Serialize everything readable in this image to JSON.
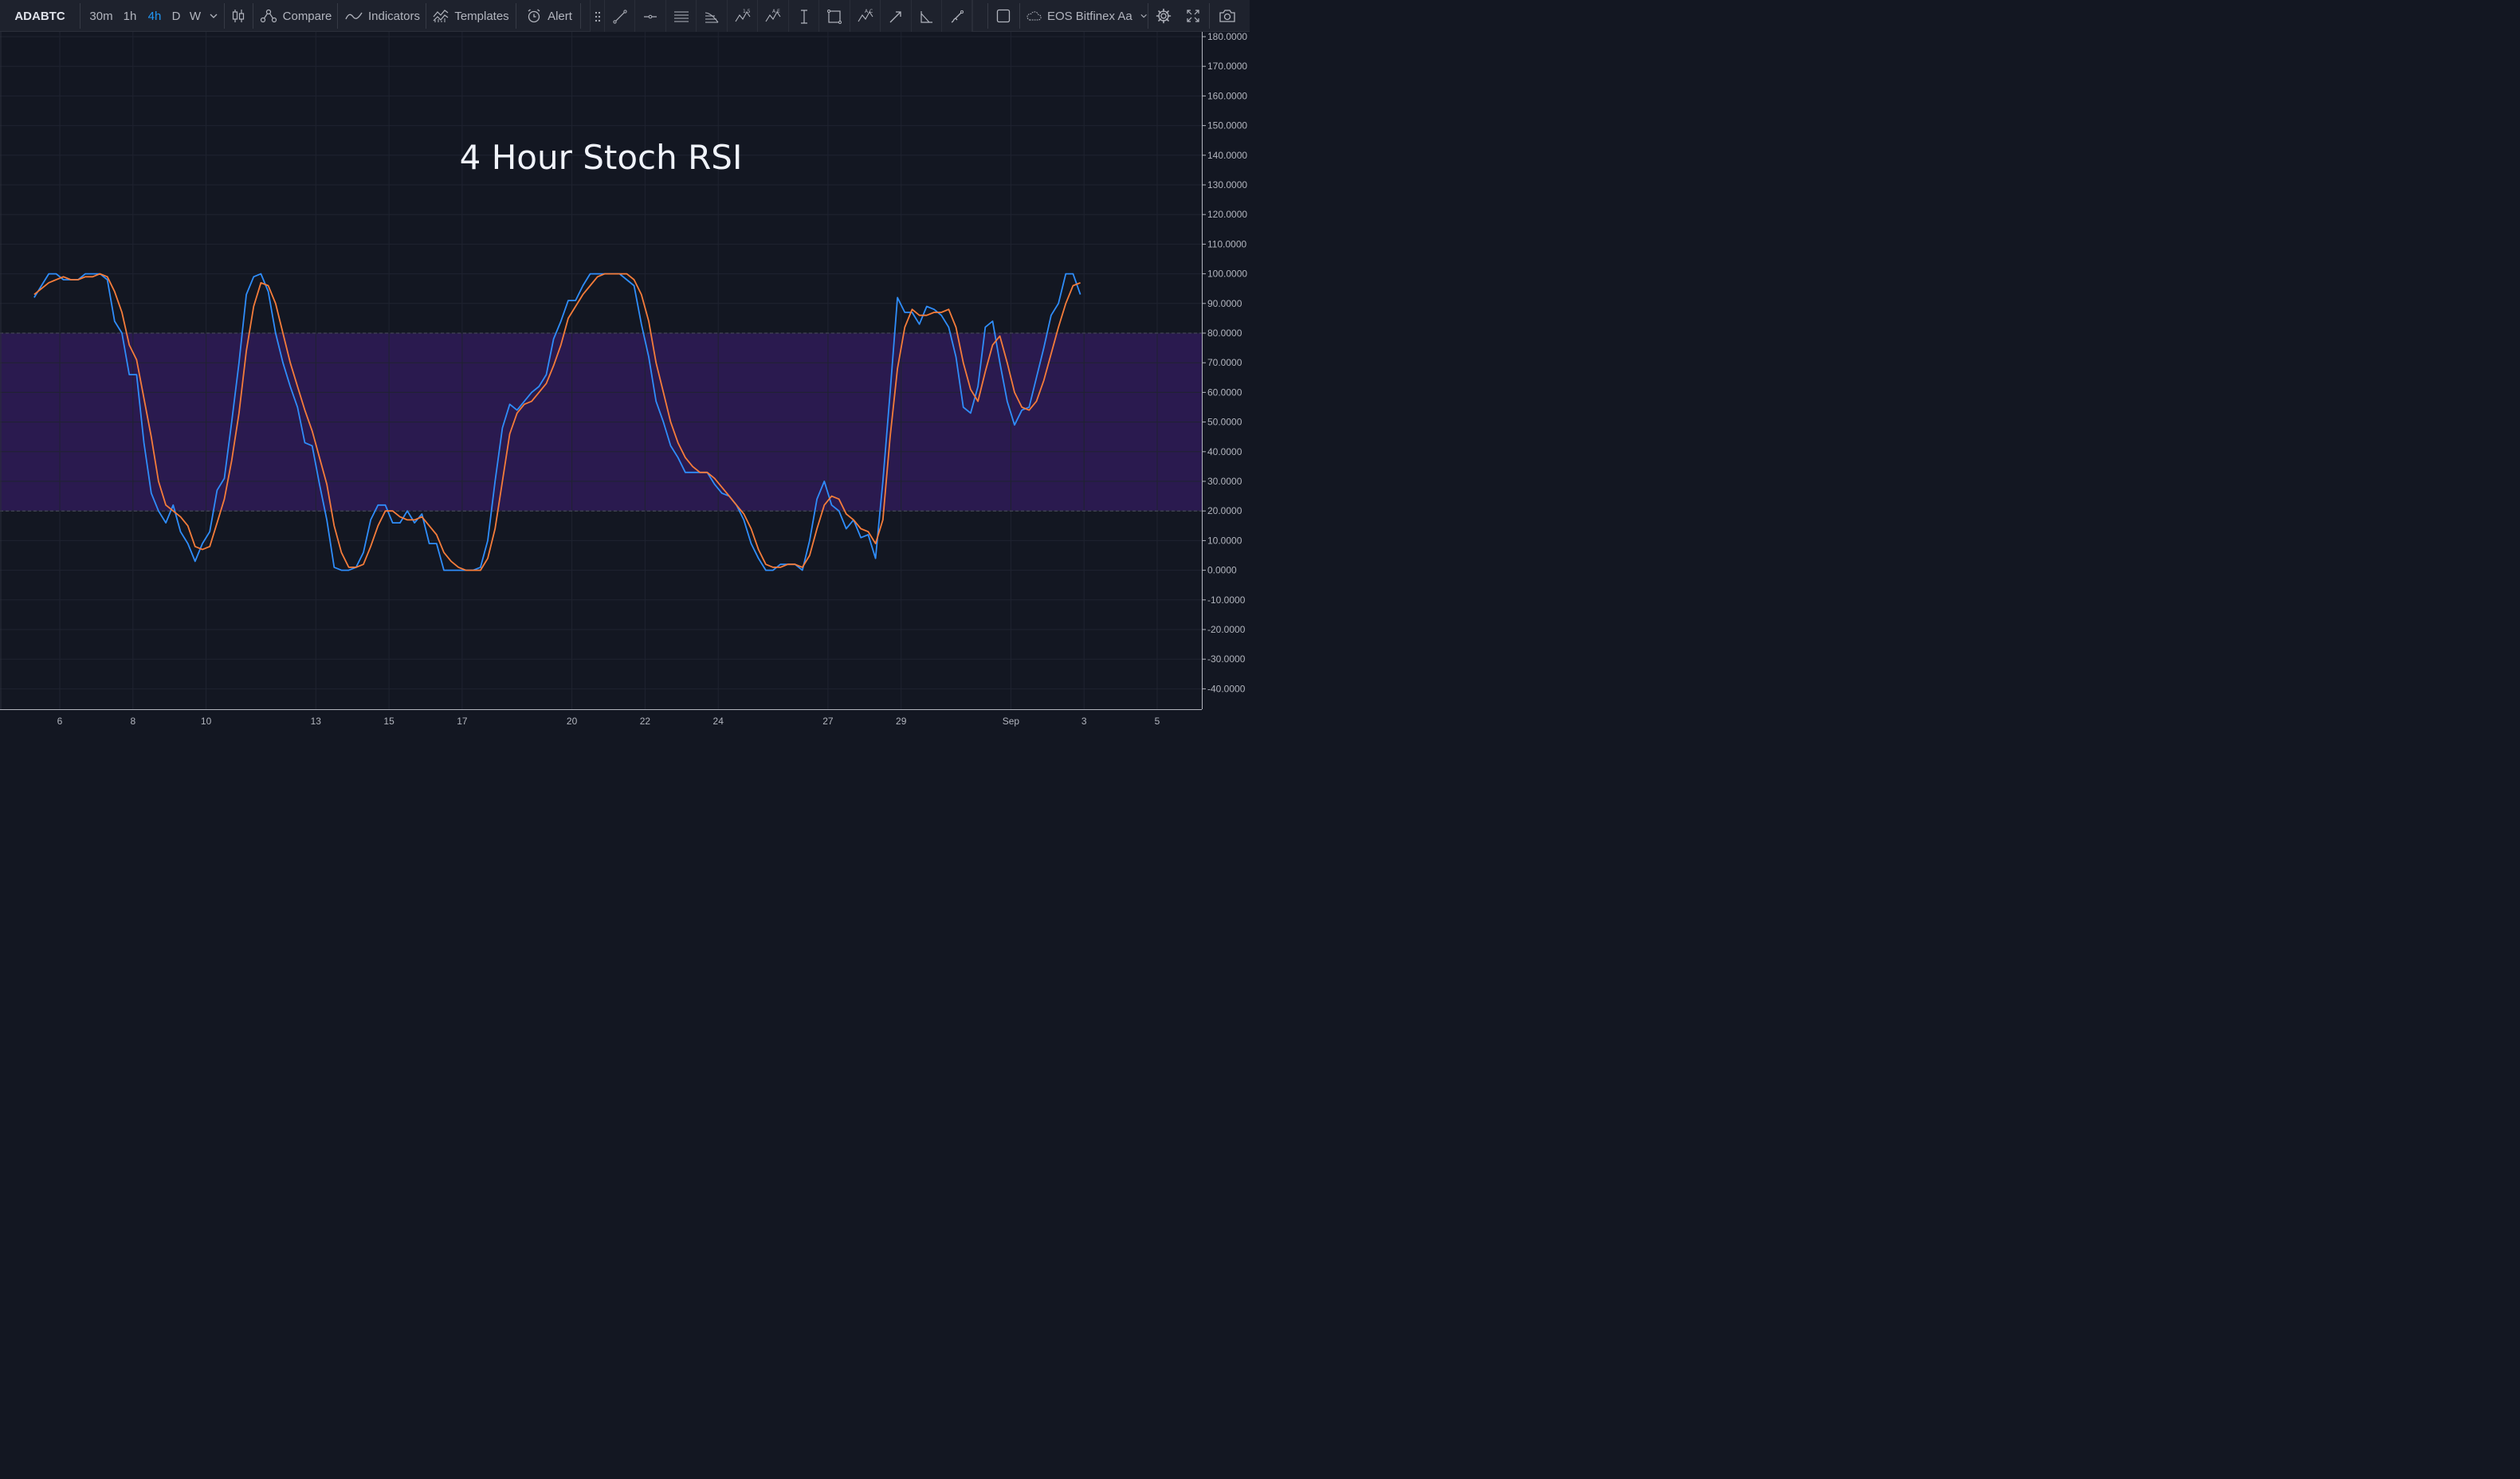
{
  "toolbar": {
    "symbol": "ADABTC",
    "intervals": [
      {
        "label": "30m",
        "active": false
      },
      {
        "label": "1h",
        "active": false
      },
      {
        "label": "4h",
        "active": true
      },
      {
        "label": "D",
        "active": false
      },
      {
        "label": "W",
        "active": false
      }
    ],
    "compare_label": "Compare",
    "indicators_label": "Indicators",
    "templates_label": "Templates",
    "alert_label": "Alert",
    "template_name": "EOS Bitfinex Aa",
    "accent_color": "#2196f3"
  },
  "drawing_tools": [
    "trend-line-icon",
    "horizontal-ray-icon",
    "parallel-lines-icon",
    "fib-retracement-icon",
    "pattern-15-icon",
    "pattern-ae-icon",
    "date-range-icon",
    "rectangle-icon",
    "pattern-ac-icon",
    "arrow-icon",
    "angle-icon",
    "brush-icon"
  ],
  "chart_data": {
    "type": "line",
    "title": "4 Hour Stoch RSI",
    "x_tick_labels": [
      "6",
      "8",
      "10",
      "13",
      "15",
      "17",
      "20",
      "22",
      "24",
      "27",
      "29",
      "Sep",
      "3",
      "5"
    ],
    "y_tick_labels": [
      "180.0000",
      "170.0000",
      "160.0000",
      "150.0000",
      "140.0000",
      "130.0000",
      "120.0000",
      "110.0000",
      "100.0000",
      "90.0000",
      "80.0000",
      "70.0000",
      "60.0000",
      "50.0000",
      "40.0000",
      "30.0000",
      "20.0000",
      "10.0000",
      "0.0000",
      "-10.0000",
      "-20.0000",
      "-30.0000",
      "-40.0000"
    ],
    "ylim": [
      -40,
      180
    ],
    "band": {
      "upper": 80,
      "lower": 20,
      "color": "#2a1a4f"
    },
    "grid": true,
    "series": [
      {
        "color": "#2f8dfa",
        "points": [
          [
            5.3,
            92
          ],
          [
            5.5,
            96
          ],
          [
            5.7,
            100
          ],
          [
            5.9,
            100
          ],
          [
            6.1,
            98
          ],
          [
            6.3,
            98
          ],
          [
            6.5,
            98
          ],
          [
            6.7,
            100
          ],
          [
            6.9,
            100
          ],
          [
            7.1,
            100
          ],
          [
            7.3,
            98
          ],
          [
            7.5,
            84
          ],
          [
            7.7,
            80
          ],
          [
            7.9,
            66
          ],
          [
            8.1,
            66
          ],
          [
            8.3,
            43
          ],
          [
            8.5,
            26
          ],
          [
            8.7,
            20
          ],
          [
            8.9,
            16
          ],
          [
            9.1,
            22
          ],
          [
            9.3,
            13
          ],
          [
            9.5,
            9
          ],
          [
            9.7,
            3
          ],
          [
            9.9,
            9
          ],
          [
            10.1,
            13
          ],
          [
            10.3,
            27
          ],
          [
            10.5,
            31
          ],
          [
            10.7,
            50
          ],
          [
            10.9,
            70
          ],
          [
            11.1,
            93
          ],
          [
            11.3,
            99
          ],
          [
            11.5,
            100
          ],
          [
            11.7,
            94
          ],
          [
            11.9,
            80
          ],
          [
            12.1,
            70
          ],
          [
            12.3,
            62
          ],
          [
            12.5,
            55
          ],
          [
            12.7,
            43
          ],
          [
            12.9,
            42
          ],
          [
            13.1,
            29
          ],
          [
            13.3,
            17
          ],
          [
            13.5,
            1
          ],
          [
            13.7,
            0
          ],
          [
            13.9,
            0
          ],
          [
            14.1,
            1
          ],
          [
            14.3,
            6
          ],
          [
            14.5,
            17
          ],
          [
            14.7,
            22
          ],
          [
            14.9,
            22
          ],
          [
            15.1,
            16
          ],
          [
            15.3,
            16
          ],
          [
            15.5,
            20
          ],
          [
            15.7,
            16
          ],
          [
            15.9,
            19
          ],
          [
            16.1,
            9
          ],
          [
            16.3,
            9
          ],
          [
            16.5,
            0
          ],
          [
            16.7,
            0
          ],
          [
            16.9,
            0
          ],
          [
            17.1,
            0
          ],
          [
            17.3,
            0
          ],
          [
            17.5,
            1
          ],
          [
            17.7,
            10
          ],
          [
            17.9,
            30
          ],
          [
            18.1,
            48
          ],
          [
            18.3,
            56
          ],
          [
            18.5,
            54
          ],
          [
            18.7,
            57
          ],
          [
            18.9,
            60
          ],
          [
            19.1,
            62
          ],
          [
            19.3,
            66
          ],
          [
            19.5,
            78
          ],
          [
            19.7,
            84
          ],
          [
            19.9,
            91
          ],
          [
            20.1,
            91
          ],
          [
            20.3,
            96
          ],
          [
            20.5,
            100
          ],
          [
            20.7,
            100
          ],
          [
            20.9,
            100
          ],
          [
            21.1,
            100
          ],
          [
            21.3,
            100
          ],
          [
            21.5,
            98
          ],
          [
            21.7,
            96
          ],
          [
            21.9,
            83
          ],
          [
            22.1,
            72
          ],
          [
            22.3,
            57
          ],
          [
            22.5,
            50
          ],
          [
            22.7,
            42
          ],
          [
            22.9,
            38
          ],
          [
            23.1,
            33
          ],
          [
            23.3,
            33
          ],
          [
            23.5,
            33
          ],
          [
            23.7,
            33
          ],
          [
            23.9,
            29
          ],
          [
            24.1,
            26
          ],
          [
            24.3,
            25
          ],
          [
            24.5,
            22
          ],
          [
            24.7,
            17
          ],
          [
            24.9,
            9
          ],
          [
            25.1,
            4
          ],
          [
            25.3,
            0
          ],
          [
            25.5,
            0
          ],
          [
            25.7,
            2
          ],
          [
            25.9,
            2
          ],
          [
            26.1,
            2
          ],
          [
            26.3,
            0
          ],
          [
            26.5,
            10
          ],
          [
            26.7,
            24
          ],
          [
            26.9,
            30
          ],
          [
            27.1,
            22
          ],
          [
            27.3,
            20
          ],
          [
            27.5,
            14
          ],
          [
            27.7,
            17
          ],
          [
            27.9,
            11
          ],
          [
            28.1,
            12
          ],
          [
            28.3,
            4
          ],
          [
            28.5,
            30
          ],
          [
            28.7,
            60
          ],
          [
            28.9,
            92
          ],
          [
            29.1,
            87
          ],
          [
            29.3,
            87
          ],
          [
            29.5,
            83
          ],
          [
            29.7,
            89
          ],
          [
            29.9,
            88
          ],
          [
            30.1,
            86
          ],
          [
            30.3,
            82
          ],
          [
            30.5,
            72
          ],
          [
            30.7,
            55
          ],
          [
            30.9,
            53
          ],
          [
            31.1,
            62
          ],
          [
            31.3,
            82
          ],
          [
            31.5,
            84
          ],
          [
            31.7,
            70
          ],
          [
            31.9,
            57
          ],
          [
            32.1,
            49
          ],
          [
            32.3,
            54
          ],
          [
            32.5,
            55
          ],
          [
            32.7,
            65
          ],
          [
            32.9,
            75
          ],
          [
            33.1,
            86
          ],
          [
            33.3,
            90
          ],
          [
            33.5,
            100
          ],
          [
            33.7,
            100
          ],
          [
            33.9,
            93
          ]
        ]
      },
      {
        "color": "#f57c3a",
        "points": [
          [
            5.3,
            93
          ],
          [
            5.5,
            95
          ],
          [
            5.7,
            97
          ],
          [
            5.9,
            98
          ],
          [
            6.1,
            99
          ],
          [
            6.3,
            98
          ],
          [
            6.5,
            98
          ],
          [
            6.7,
            99
          ],
          [
            6.9,
            99
          ],
          [
            7.1,
            100
          ],
          [
            7.3,
            99
          ],
          [
            7.5,
            94
          ],
          [
            7.7,
            87
          ],
          [
            7.9,
            76
          ],
          [
            8.1,
            71
          ],
          [
            8.3,
            58
          ],
          [
            8.5,
            45
          ],
          [
            8.7,
            30
          ],
          [
            8.9,
            22
          ],
          [
            9.1,
            20
          ],
          [
            9.3,
            18
          ],
          [
            9.5,
            15
          ],
          [
            9.7,
            8
          ],
          [
            9.9,
            7
          ],
          [
            10.1,
            8
          ],
          [
            10.3,
            16
          ],
          [
            10.5,
            24
          ],
          [
            10.7,
            37
          ],
          [
            10.9,
            53
          ],
          [
            11.1,
            74
          ],
          [
            11.3,
            89
          ],
          [
            11.5,
            97
          ],
          [
            11.7,
            96
          ],
          [
            11.9,
            90
          ],
          [
            12.1,
            80
          ],
          [
            12.3,
            70
          ],
          [
            12.5,
            62
          ],
          [
            12.7,
            54
          ],
          [
            12.9,
            47
          ],
          [
            13.1,
            38
          ],
          [
            13.3,
            29
          ],
          [
            13.5,
            15
          ],
          [
            13.7,
            6
          ],
          [
            13.9,
            1
          ],
          [
            14.1,
            1
          ],
          [
            14.3,
            2
          ],
          [
            14.5,
            8
          ],
          [
            14.7,
            15
          ],
          [
            14.9,
            20
          ],
          [
            15.1,
            20
          ],
          [
            15.3,
            18
          ],
          [
            15.5,
            17
          ],
          [
            15.7,
            17
          ],
          [
            15.9,
            18
          ],
          [
            16.1,
            15
          ],
          [
            16.3,
            12
          ],
          [
            16.5,
            6
          ],
          [
            16.7,
            3
          ],
          [
            16.9,
            1
          ],
          [
            17.1,
            0
          ],
          [
            17.3,
            0
          ],
          [
            17.5,
            0
          ],
          [
            17.7,
            4
          ],
          [
            17.9,
            14
          ],
          [
            18.1,
            30
          ],
          [
            18.3,
            46
          ],
          [
            18.5,
            53
          ],
          [
            18.7,
            56
          ],
          [
            18.9,
            57
          ],
          [
            19.1,
            60
          ],
          [
            19.3,
            63
          ],
          [
            19.5,
            69
          ],
          [
            19.7,
            76
          ],
          [
            19.9,
            85
          ],
          [
            20.1,
            89
          ],
          [
            20.3,
            93
          ],
          [
            20.5,
            96
          ],
          [
            20.7,
            99
          ],
          [
            20.9,
            100
          ],
          [
            21.1,
            100
          ],
          [
            21.3,
            100
          ],
          [
            21.5,
            100
          ],
          [
            21.7,
            98
          ],
          [
            21.9,
            93
          ],
          [
            22.1,
            84
          ],
          [
            22.3,
            70
          ],
          [
            22.5,
            60
          ],
          [
            22.7,
            50
          ],
          [
            22.9,
            43
          ],
          [
            23.1,
            38
          ],
          [
            23.3,
            35
          ],
          [
            23.5,
            33
          ],
          [
            23.7,
            33
          ],
          [
            23.9,
            31
          ],
          [
            24.1,
            28
          ],
          [
            24.3,
            25
          ],
          [
            24.5,
            22
          ],
          [
            24.7,
            19
          ],
          [
            24.9,
            14
          ],
          [
            25.1,
            7
          ],
          [
            25.3,
            2
          ],
          [
            25.5,
            1
          ],
          [
            25.7,
            1
          ],
          [
            25.9,
            2
          ],
          [
            26.1,
            2
          ],
          [
            26.3,
            1
          ],
          [
            26.5,
            5
          ],
          [
            26.7,
            14
          ],
          [
            26.9,
            22
          ],
          [
            27.1,
            25
          ],
          [
            27.3,
            24
          ],
          [
            27.5,
            19
          ],
          [
            27.7,
            17
          ],
          [
            27.9,
            14
          ],
          [
            28.1,
            13
          ],
          [
            28.3,
            9
          ],
          [
            28.5,
            17
          ],
          [
            28.7,
            45
          ],
          [
            28.9,
            68
          ],
          [
            29.1,
            82
          ],
          [
            29.3,
            88
          ],
          [
            29.5,
            86
          ],
          [
            29.7,
            86
          ],
          [
            29.9,
            87
          ],
          [
            30.1,
            87
          ],
          [
            30.3,
            88
          ],
          [
            30.5,
            82
          ],
          [
            30.7,
            70
          ],
          [
            30.9,
            61
          ],
          [
            31.1,
            57
          ],
          [
            31.3,
            67
          ],
          [
            31.5,
            76
          ],
          [
            31.7,
            79
          ],
          [
            31.9,
            70
          ],
          [
            32.1,
            60
          ],
          [
            32.3,
            55
          ],
          [
            32.5,
            54
          ],
          [
            32.7,
            57
          ],
          [
            32.9,
            64
          ],
          [
            33.1,
            73
          ],
          [
            33.3,
            82
          ],
          [
            33.5,
            90
          ],
          [
            33.7,
            96
          ],
          [
            33.9,
            97
          ]
        ]
      }
    ]
  }
}
